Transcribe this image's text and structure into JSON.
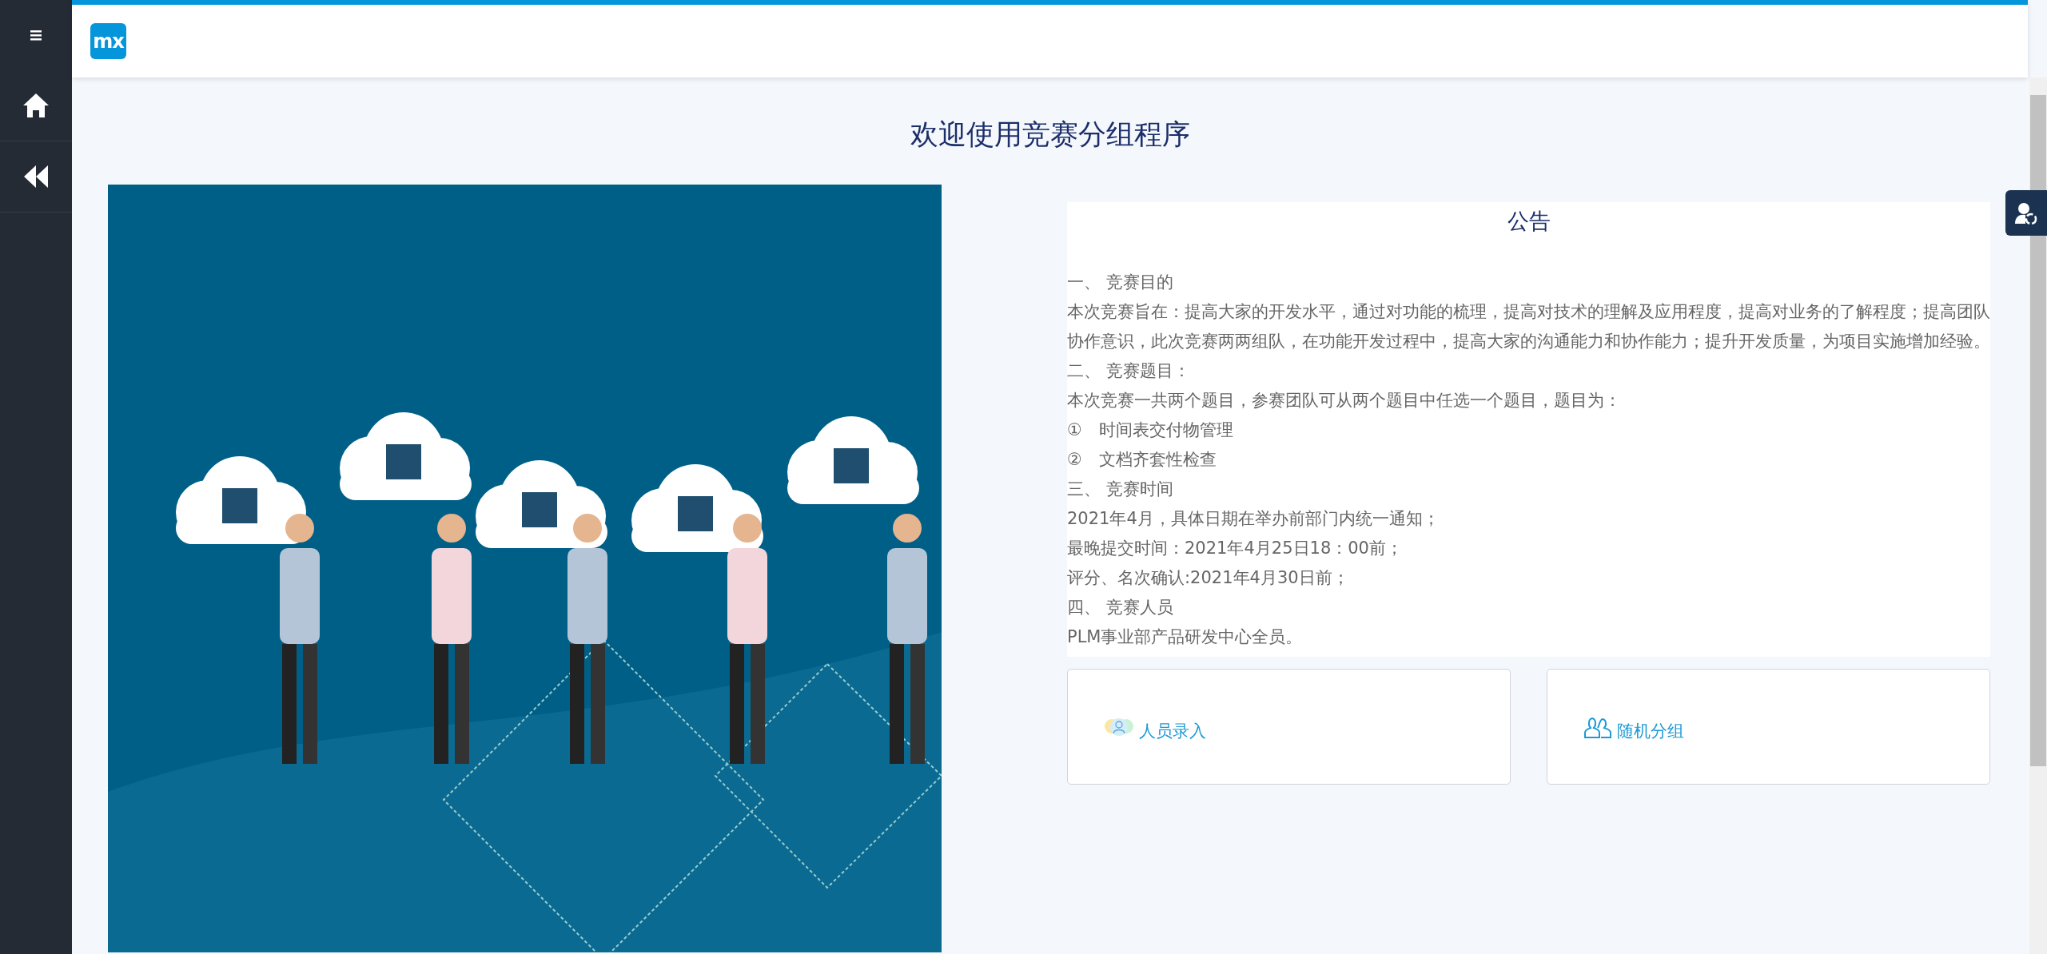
{
  "header": {
    "logo_text": "mx"
  },
  "page_title": "欢迎使用竞赛分组程序",
  "notice": {
    "title": "公告",
    "lines": [
      "一、 竞赛目的",
      "本次竞赛旨在：提高大家的开发水平，通过对功能的梳理，提高对技术的理解及应用程度，提高对业务的了解程度；提高团队协作意识，此次竞赛两两组队，在功能开发过程中，提高大家的沟通能力和协作能力；提升开发质量，为项目实施增加经验。",
      "二、 竞赛题目：",
      "本次竞赛一共两个题目，参赛团队可从两个题目中任选一个题目，题目为：",
      "①　时间表交付物管理",
      "②　文档齐套性检查",
      "三、 竞赛时间",
      "2021年4月，具体日期在举办前部门内统一通知；",
      "最晚提交时间：2021年4月25日18：00前；",
      "评分、名次确认:2021年4月30日前；",
      "四、 竞赛人员",
      "PLM事业部产品研发中心全员。"
    ]
  },
  "actions": [
    {
      "kind": "entry",
      "label": "人员录入"
    },
    {
      "kind": "group",
      "label": "随机分组"
    }
  ]
}
